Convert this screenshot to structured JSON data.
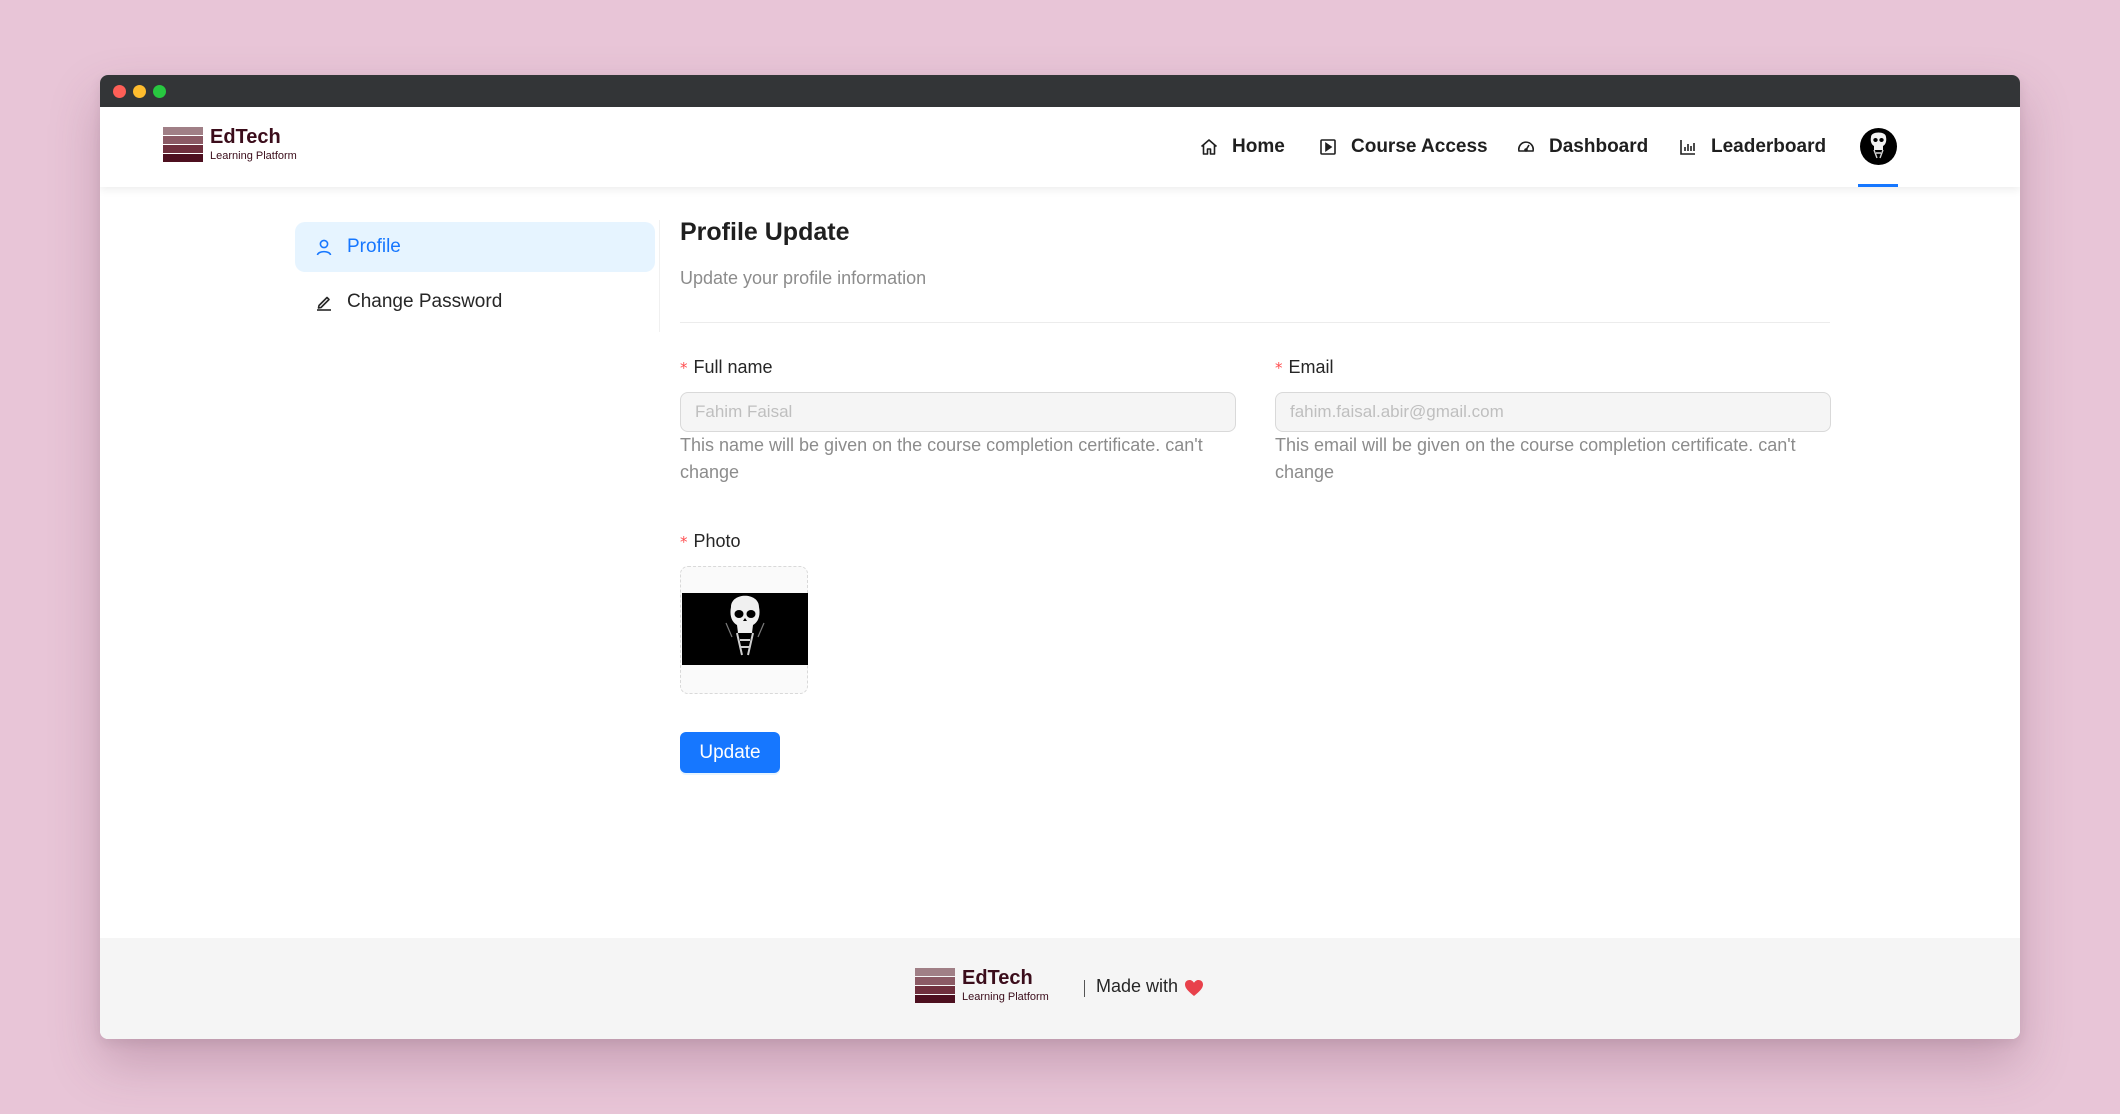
{
  "brand": {
    "name": "EdTech",
    "tagline": "Learning Platform",
    "colors": [
      "#a07f86",
      "#8b5a65",
      "#6f2f3d",
      "#4d0f1f"
    ]
  },
  "nav": {
    "items": [
      {
        "label": "Home",
        "icon": "home-icon"
      },
      {
        "label": "Course Access",
        "icon": "play-square-icon"
      },
      {
        "label": "Dashboard",
        "icon": "dashboard-icon"
      },
      {
        "label": "Leaderboard",
        "icon": "bar-chart-icon"
      }
    ],
    "accent": "#1677ff"
  },
  "sidebar": {
    "items": [
      {
        "label": "Profile",
        "icon": "user-icon",
        "active": true
      },
      {
        "label": "Change Password",
        "icon": "edit-icon",
        "active": false
      }
    ]
  },
  "main": {
    "title": "Profile Update",
    "subtitle": "Update your profile information",
    "fields": [
      {
        "label": "Full name",
        "value": "Fahim Faisal",
        "help": "This name will be given on the course completion certificate. can't change"
      },
      {
        "label": "Email",
        "value": "fahim.faisal.abir@gmail.com",
        "help": "This email will be given on the course completion certificate. can't change"
      }
    ],
    "photo_label": "Photo",
    "update_button": "Update"
  },
  "footer": {
    "made_with": "Made with"
  }
}
